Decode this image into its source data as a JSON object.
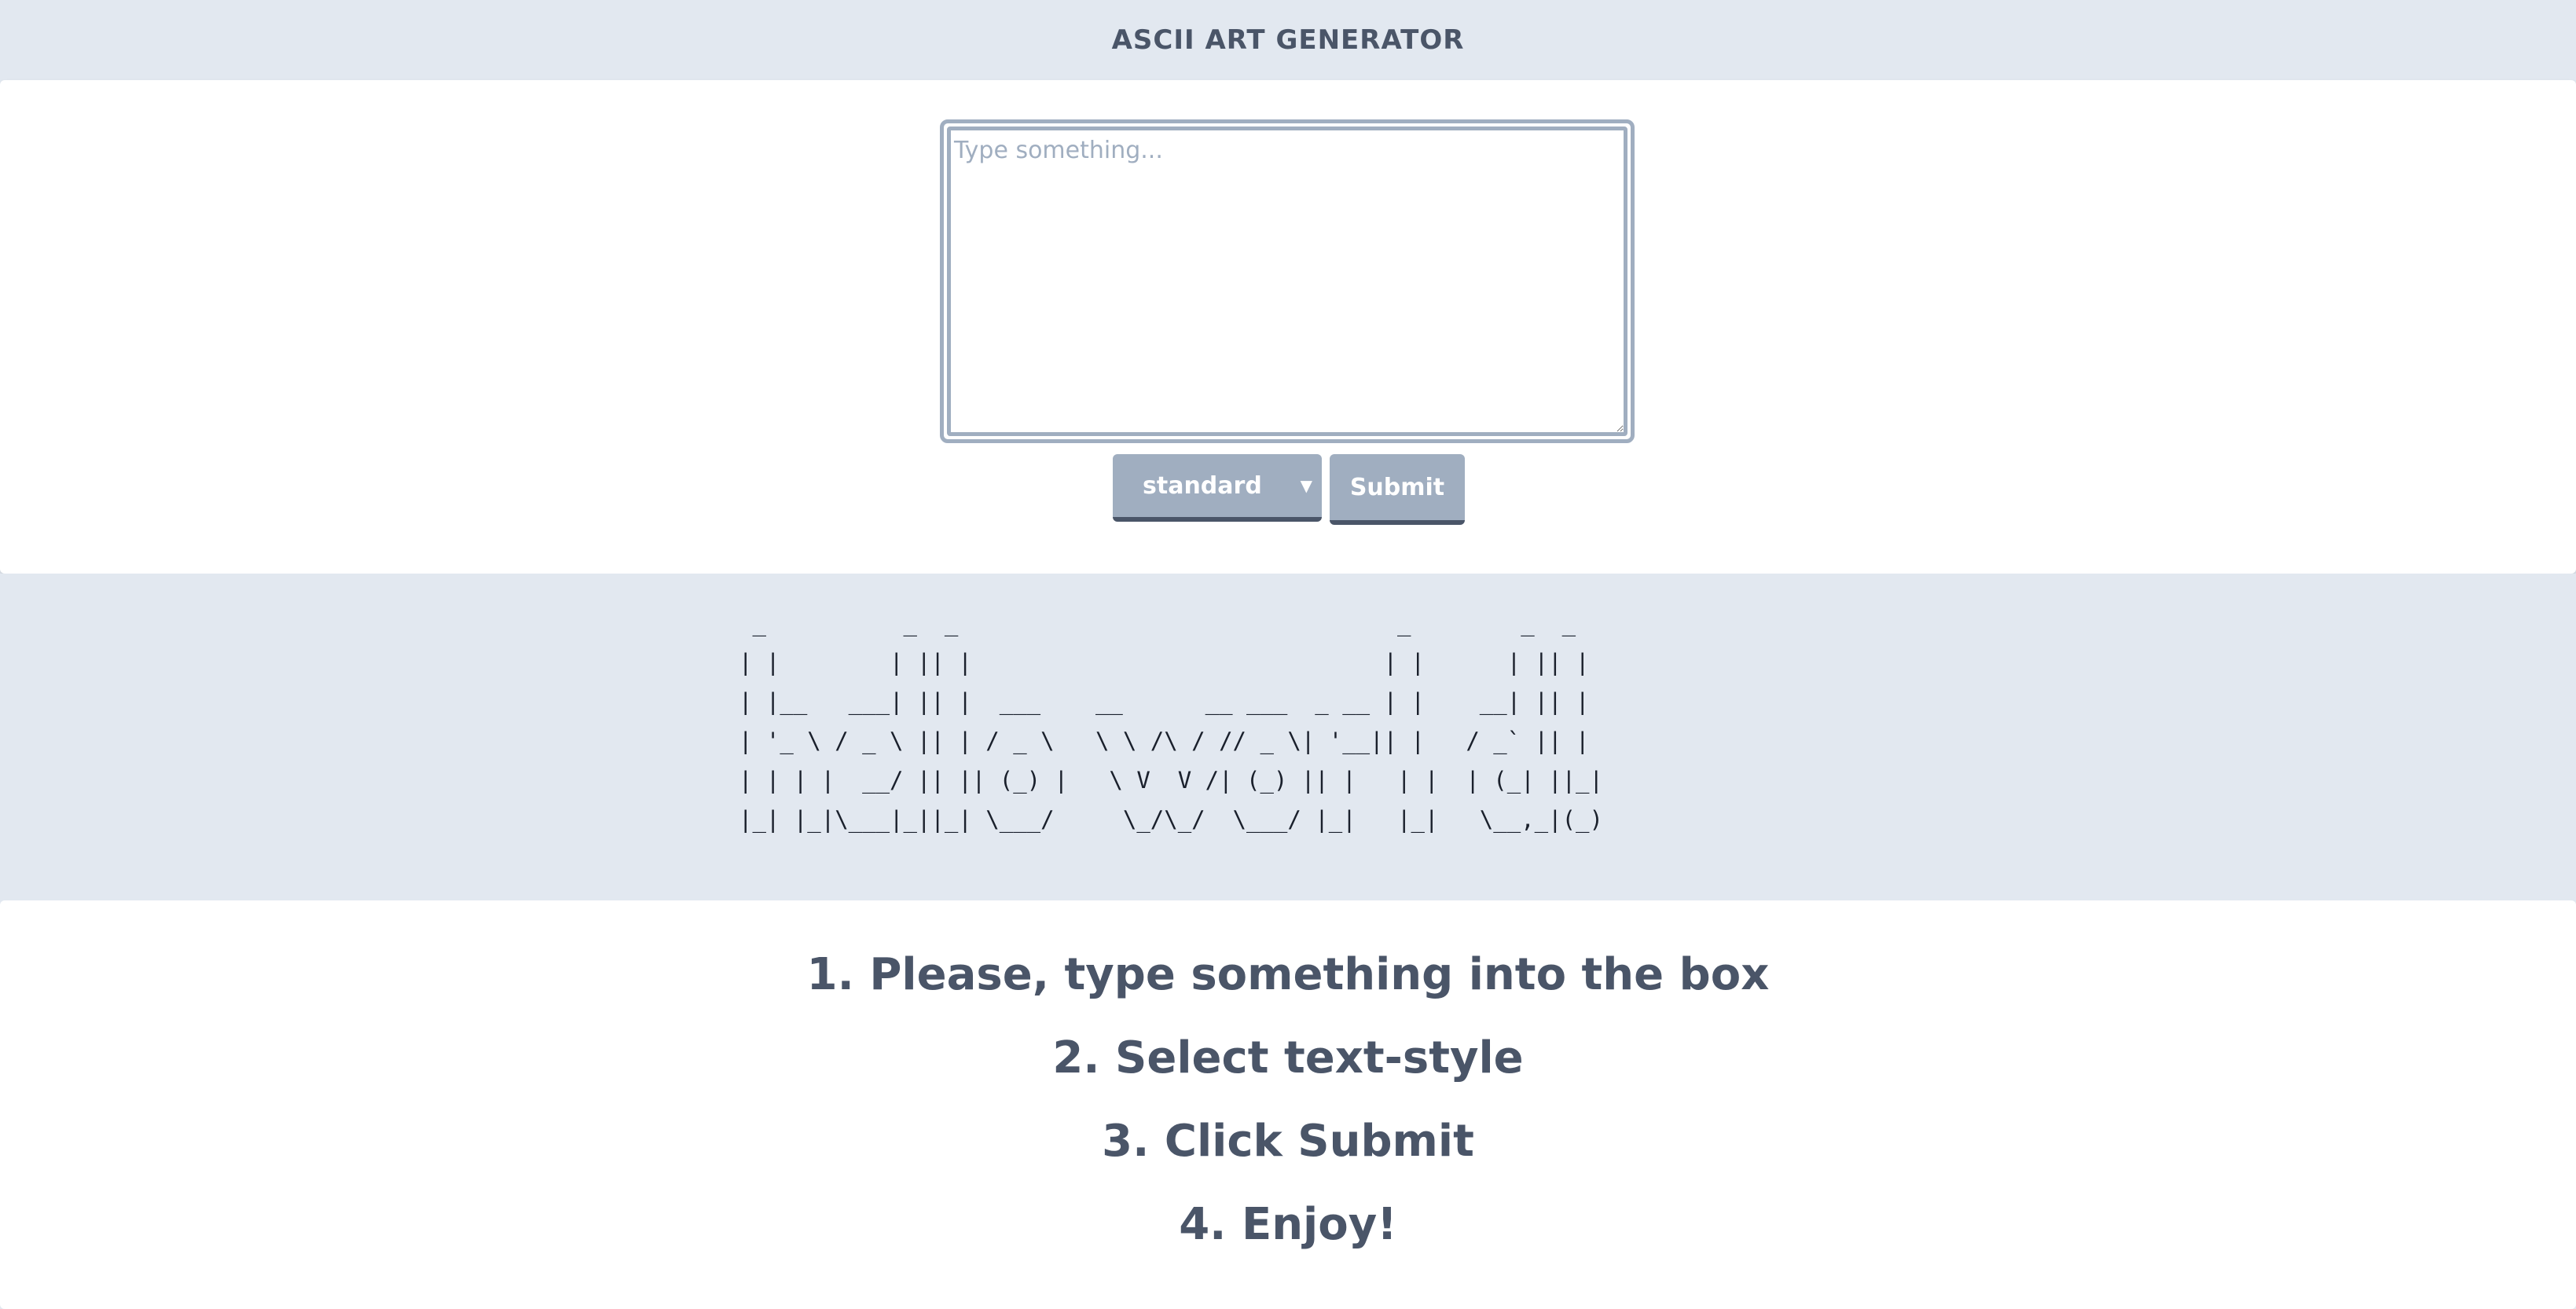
{
  "header": {
    "title": "ASCII ART GENERATOR"
  },
  "input": {
    "placeholder": "Type something...",
    "value": ""
  },
  "controls": {
    "style_selected": "standard",
    "submit_label": "Submit"
  },
  "output": {
    "ascii": " _          _  _                                _        _  _ \n| |        | || |                              | |      | || |\n| |__   ___| || |  ___    __      __ ___  _ __ | |    __| || |\n| '_ \\ / _ \\ || | / _ \\   \\ \\ /\\ / // _ \\| '__|| |   / _` || |\n| | | |  __/ || || (_) |   \\ V  V /| (_) || |   | |  | (_| ||_|\n|_| |_|\\___|_||_| \\___/     \\_/\\_/  \\___/ |_|   |_|   \\__,_|(_)"
  },
  "instructions": [
    "1. Please, type something into the box",
    "2. Select text-style",
    "3. Click Submit",
    "4. Enjoy!"
  ],
  "colors": {
    "background": "#e2e8f0",
    "panel": "#ffffff",
    "accent": "#a0aec0",
    "text": "#4a5568"
  }
}
